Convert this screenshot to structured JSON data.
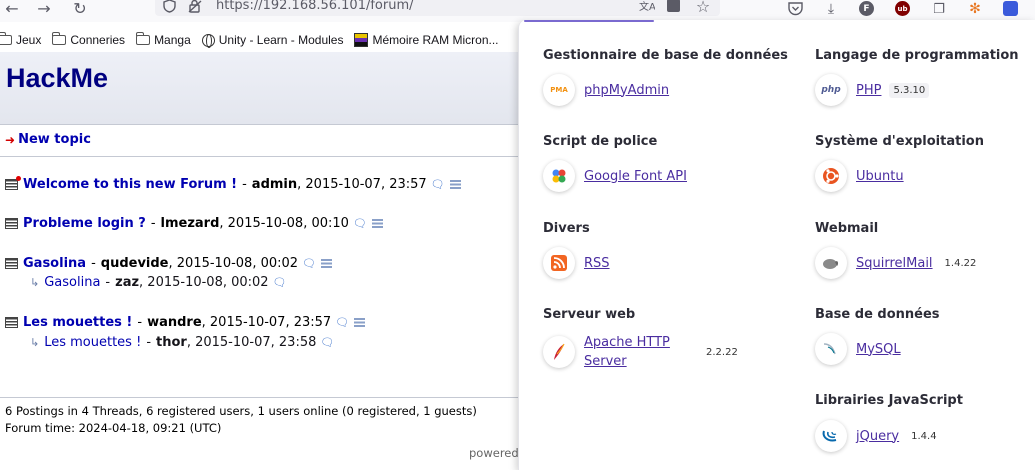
{
  "browser": {
    "url": "https://192.168.56.101/forum/",
    "bookmarks": [
      {
        "label": "Jeux",
        "icon": "folder-icon"
      },
      {
        "label": "Conneries",
        "icon": "folder-icon"
      },
      {
        "label": "Manga",
        "icon": "folder-icon"
      },
      {
        "label": "Unity - Learn - Modules",
        "icon": "globe-icon"
      },
      {
        "label": "Mémoire RAM Micron...",
        "icon": "memory-icon"
      }
    ]
  },
  "forum": {
    "title": "HackMe",
    "new_topic_label": "New topic",
    "threads": [
      {
        "subject": "Welcome to this new Forum !",
        "author": "admin",
        "date": "2015-10-07, 23:57",
        "unread": true
      },
      {
        "subject": "Probleme login ?",
        "author": "lmezard",
        "date": "2015-10-08, 00:10",
        "unread": false
      },
      {
        "subject": "Gasolina",
        "author": "qudevide",
        "date": "2015-10-08, 00:02",
        "unread": false,
        "reply": {
          "subject": "Gasolina",
          "author": "zaz",
          "date": "2015-10-08, 00:02"
        }
      },
      {
        "subject": "Les mouettes !",
        "author": "wandre",
        "date": "2015-10-07, 23:57",
        "unread": false,
        "reply": {
          "subject": "Les mouettes !",
          "author": "thor",
          "date": "2015-10-07, 23:58"
        }
      }
    ],
    "separator": "-",
    "stats_line": "6 Postings in 4 Threads, 6 registered users, 1 users online (0 registered, 1 guests)",
    "time_line": "Forum time: 2024-04-18, 09:21 (UTC)",
    "powered": "powered"
  },
  "panel": {
    "categories": [
      {
        "name": "Gestionnaire de base de données",
        "tech": "phpMyAdmin",
        "version": "",
        "icon": "phpmyadmin-icon",
        "badge": "PMA",
        "color": "#f29111"
      },
      {
        "name": "Langage de programmation",
        "tech": "PHP",
        "version": "5.3.10",
        "icon": "php-icon",
        "badge": "php",
        "color": "#4f5b93"
      },
      {
        "name": "Script de police",
        "tech": "Google Font API",
        "version": "",
        "icon": "google-font-icon",
        "badge": "",
        "color": "#34a853"
      },
      {
        "name": "Système d'exploitation",
        "tech": "Ubuntu",
        "version": "",
        "icon": "ubuntu-icon",
        "badge": "",
        "color": "#e95420"
      },
      {
        "name": "Divers",
        "tech": "RSS",
        "version": "",
        "icon": "rss-icon",
        "badge": "",
        "color": "#f26522"
      },
      {
        "name": "Webmail",
        "tech": "SquirrelMail",
        "version": "1.4.22",
        "icon": "squirrelmail-icon",
        "badge": "",
        "color": "#777777"
      },
      {
        "name": "Serveur web",
        "tech": "Apache HTTP Server",
        "version": "2.2.22",
        "icon": "apache-icon",
        "badge": "",
        "color": "#c92037"
      },
      {
        "name": "Base de données",
        "tech": "MySQL",
        "version": "",
        "icon": "mysql-icon",
        "badge": "",
        "color": "#00758f"
      },
      {
        "name": "Librairies JavaScript",
        "tech": "jQuery",
        "version": "1.4.4",
        "icon": "jquery-icon",
        "badge": "",
        "color": "#0769ad"
      }
    ]
  }
}
